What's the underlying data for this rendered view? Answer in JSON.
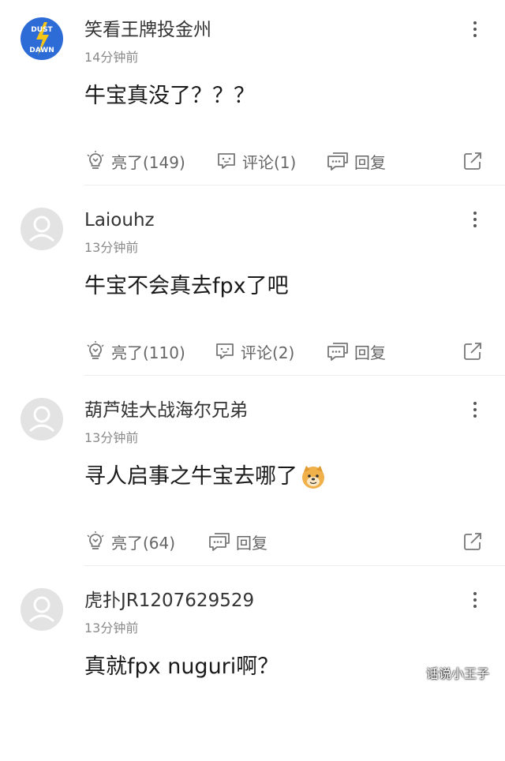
{
  "comments": [
    {
      "username": "笑看王牌投金州",
      "time": "14分钟前",
      "text": "牛宝真没了？？？",
      "avatar_text": [
        "DUST",
        "DAWN"
      ],
      "like_label": "亮了(149)",
      "comment_label": "评论(1)",
      "reply_label": "回复"
    },
    {
      "username": "Laiouhz",
      "time": "13分钟前",
      "text": "牛宝不会真去fpx了吧",
      "like_label": "亮了(110)",
      "comment_label": "评论(2)",
      "reply_label": "回复"
    },
    {
      "username": "葫芦娃大战海尔兄弟",
      "time": "13分钟前",
      "text": "寻人启事之牛宝去哪了",
      "like_label": "亮了(64)",
      "reply_label": "回复"
    },
    {
      "username": "虎扑JR1207629529",
      "time": "13分钟前",
      "text": "真就fpx nuguri啊？"
    }
  ],
  "watermark": "话说小王子",
  "colors": {
    "icon_gray": "#666666",
    "avatar_brand": "#2d6bd6",
    "avatar_default": "#e3e3e3"
  }
}
